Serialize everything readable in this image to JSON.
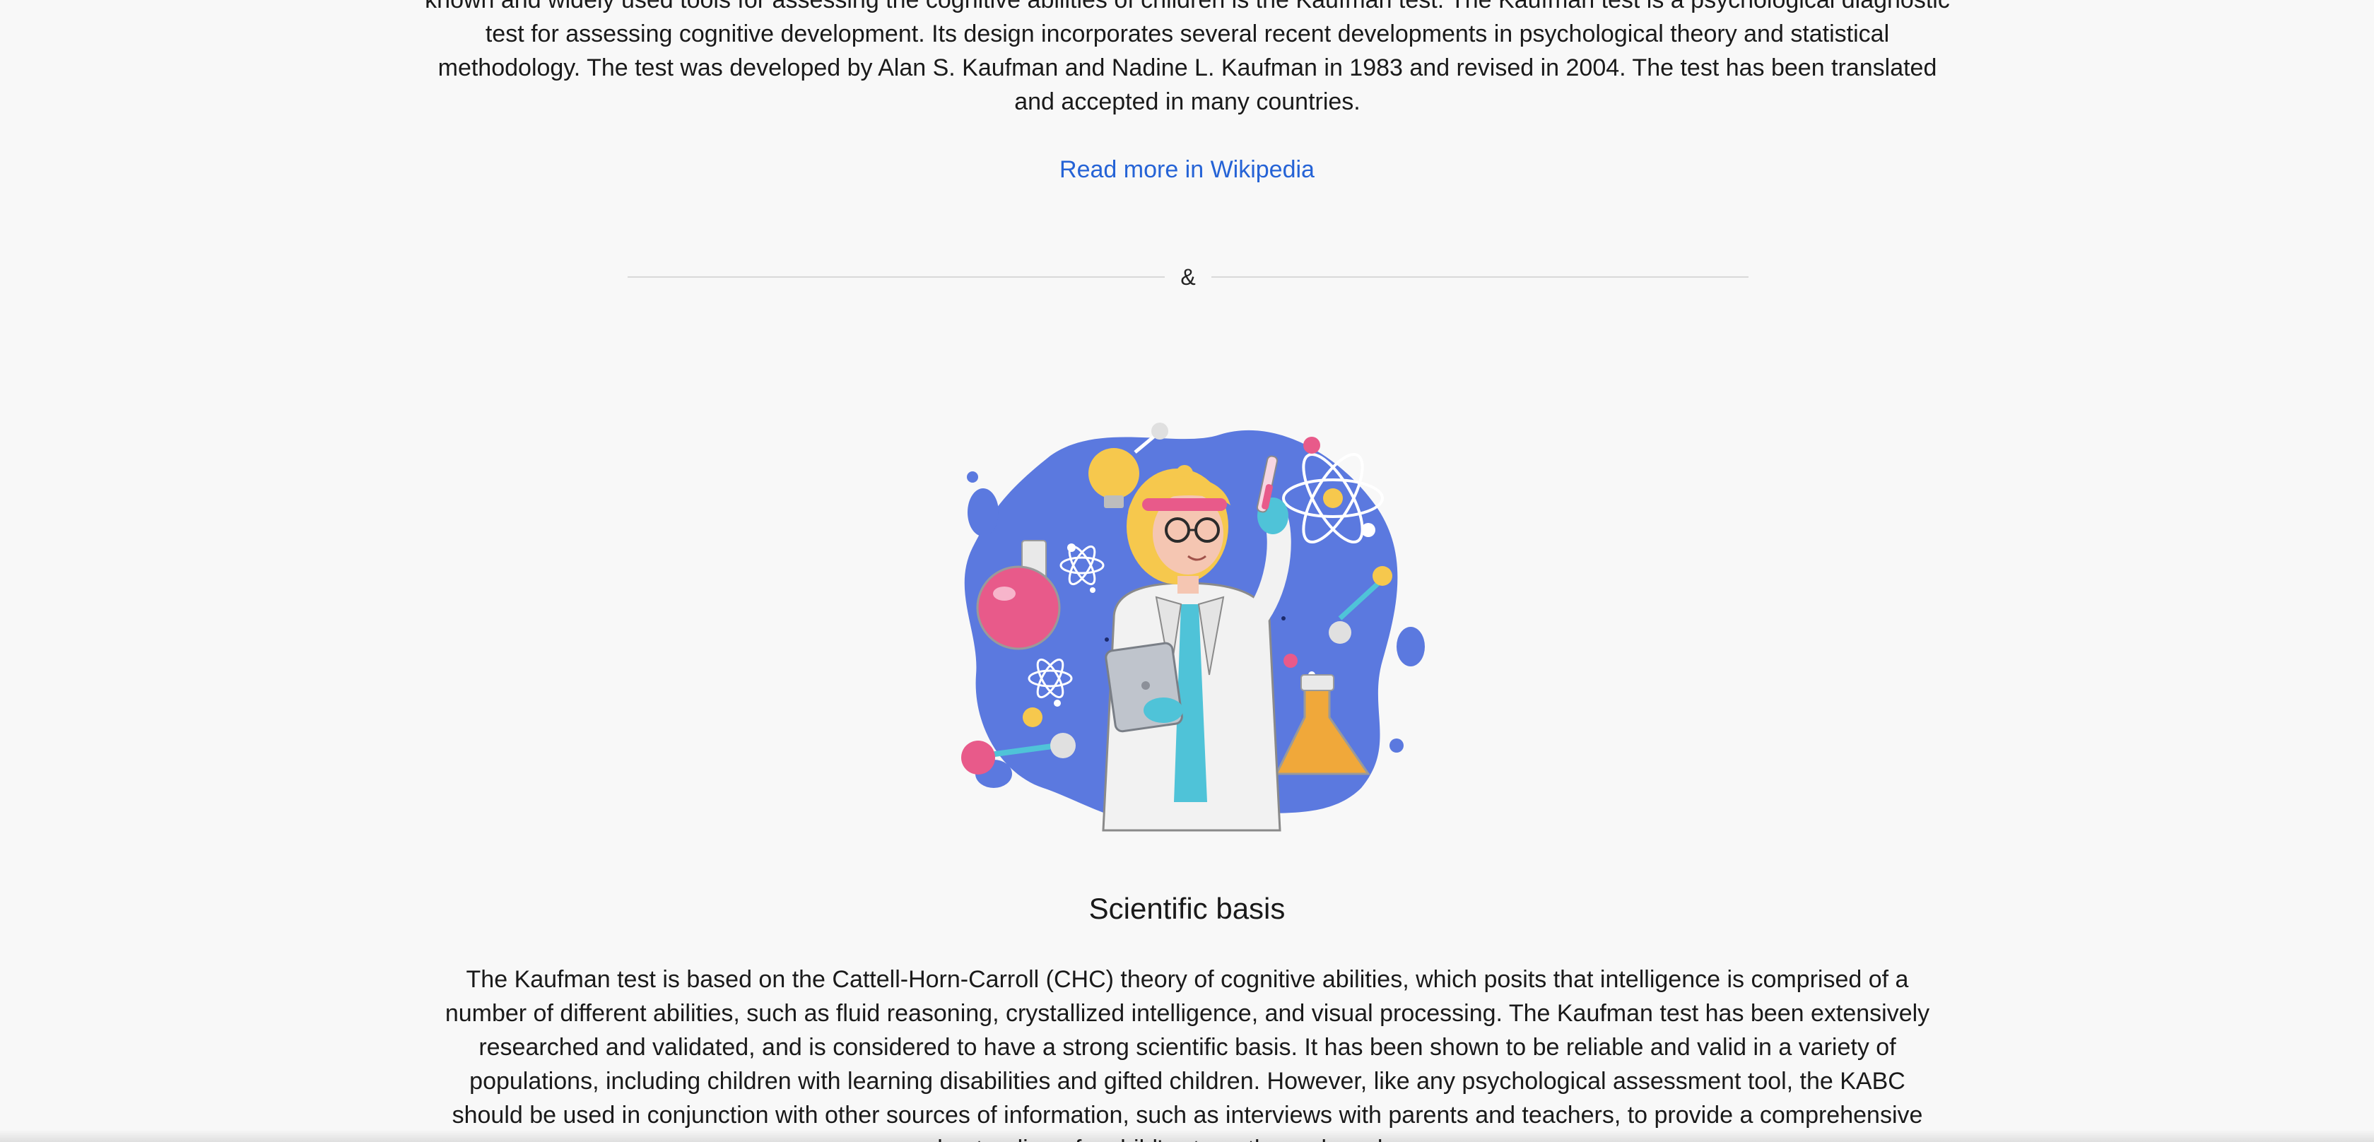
{
  "intro": {
    "text": "known and widely used tools for assessing the cognitive abilities of children is the Kaufman test. The Kaufman test is a psychological diagnostic test for assessing cognitive development. Its design incorporates several recent developments in psychological theory and statistical methodology. The test was developed by Alan S. Kaufman and Nadine L. Kaufman in 1983 and revised in 2004. The test has been translated and accepted in many countries."
  },
  "read_more": {
    "label": "Read more in Wikipedia"
  },
  "divider": {
    "symbol": "&"
  },
  "illustration": {
    "icon": "scientist-illustration",
    "colors": {
      "blob": "#5b79df",
      "hair": "#f4c84a",
      "coat": "#f2f2f2",
      "tie": "#4fc3d8",
      "flask_pink": "#e85a8a",
      "flask_orange": "#f0a83a"
    }
  },
  "section": {
    "title": "Scientific basis",
    "body": "The Kaufman test is based on the Cattell-Horn-Carroll (CHC) theory of cognitive abilities, which posits that intelligence is comprised of a number of different abilities, such as fluid reasoning, crystallized intelligence, and visual processing. The Kaufman test has been extensively researched and validated, and is considered to have a strong scientific basis. It has been shown to be reliable and valid in a variety of populations, including children with learning disabilities and gifted children. However, like any psychological assessment tool, the KABC should be used in conjunction with other sources of information, such as interviews with parents and teachers, to provide a comprehensive understanding of a child's strengths and weaknesses."
  },
  "colors": {
    "background": "#f8f8f8",
    "link": "#2563d6",
    "text": "#1a1a1a"
  }
}
